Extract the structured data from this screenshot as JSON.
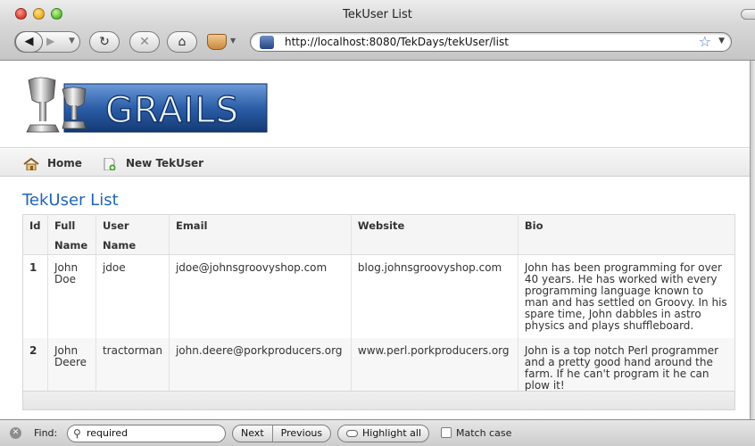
{
  "window": {
    "title": "TekUser List"
  },
  "toolbar": {
    "back_icon": "left-arrow-icon",
    "forward_icon": "right-arrow-icon",
    "reload_icon": "reload-icon",
    "stop_icon": "stop-icon",
    "home_icon": "home-icon",
    "url": "http://localhost:8080/TekDays/tekUser/list"
  },
  "logo": {
    "text": "GRAILS"
  },
  "nav": {
    "home": "Home",
    "new_tekuser": "New TekUser"
  },
  "page": {
    "title": "TekUser List"
  },
  "table": {
    "columns": [
      {
        "line1": "Id",
        "line2": ""
      },
      {
        "line1": "Full",
        "line2": "Name"
      },
      {
        "line1": "User",
        "line2": "Name"
      },
      {
        "line1": "Email",
        "line2": ""
      },
      {
        "line1": "Website",
        "line2": ""
      },
      {
        "line1": "Bio",
        "line2": ""
      }
    ],
    "rows": [
      {
        "id": "1",
        "full_name": "John Doe",
        "user_name": "jdoe",
        "email": "jdoe@johnsgroovyshop.com",
        "website": "blog.johnsgroovyshop.com",
        "bio": "John has been programming for over 40 years. He has worked with every programming language known to man and has settled on Groovy. In his spare time, John dabbles in astro physics and plays shuffleboard."
      },
      {
        "id": "2",
        "full_name": "John Deere",
        "user_name": "tractorman",
        "email": "john.deere@porkproducers.org",
        "website": "www.perl.porkproducers.org",
        "bio": "John is a top notch Perl programmer and a pretty good hand around the farm. If he can't program it he can plow it!"
      }
    ]
  },
  "findbar": {
    "label": "Find:",
    "query": "required",
    "next": "Next",
    "previous": "Previous",
    "highlight_all": "Highlight all",
    "match_case": "Match case"
  },
  "colors": {
    "accent": "#1f65b4",
    "logo_blue": "#2a5fa8"
  }
}
